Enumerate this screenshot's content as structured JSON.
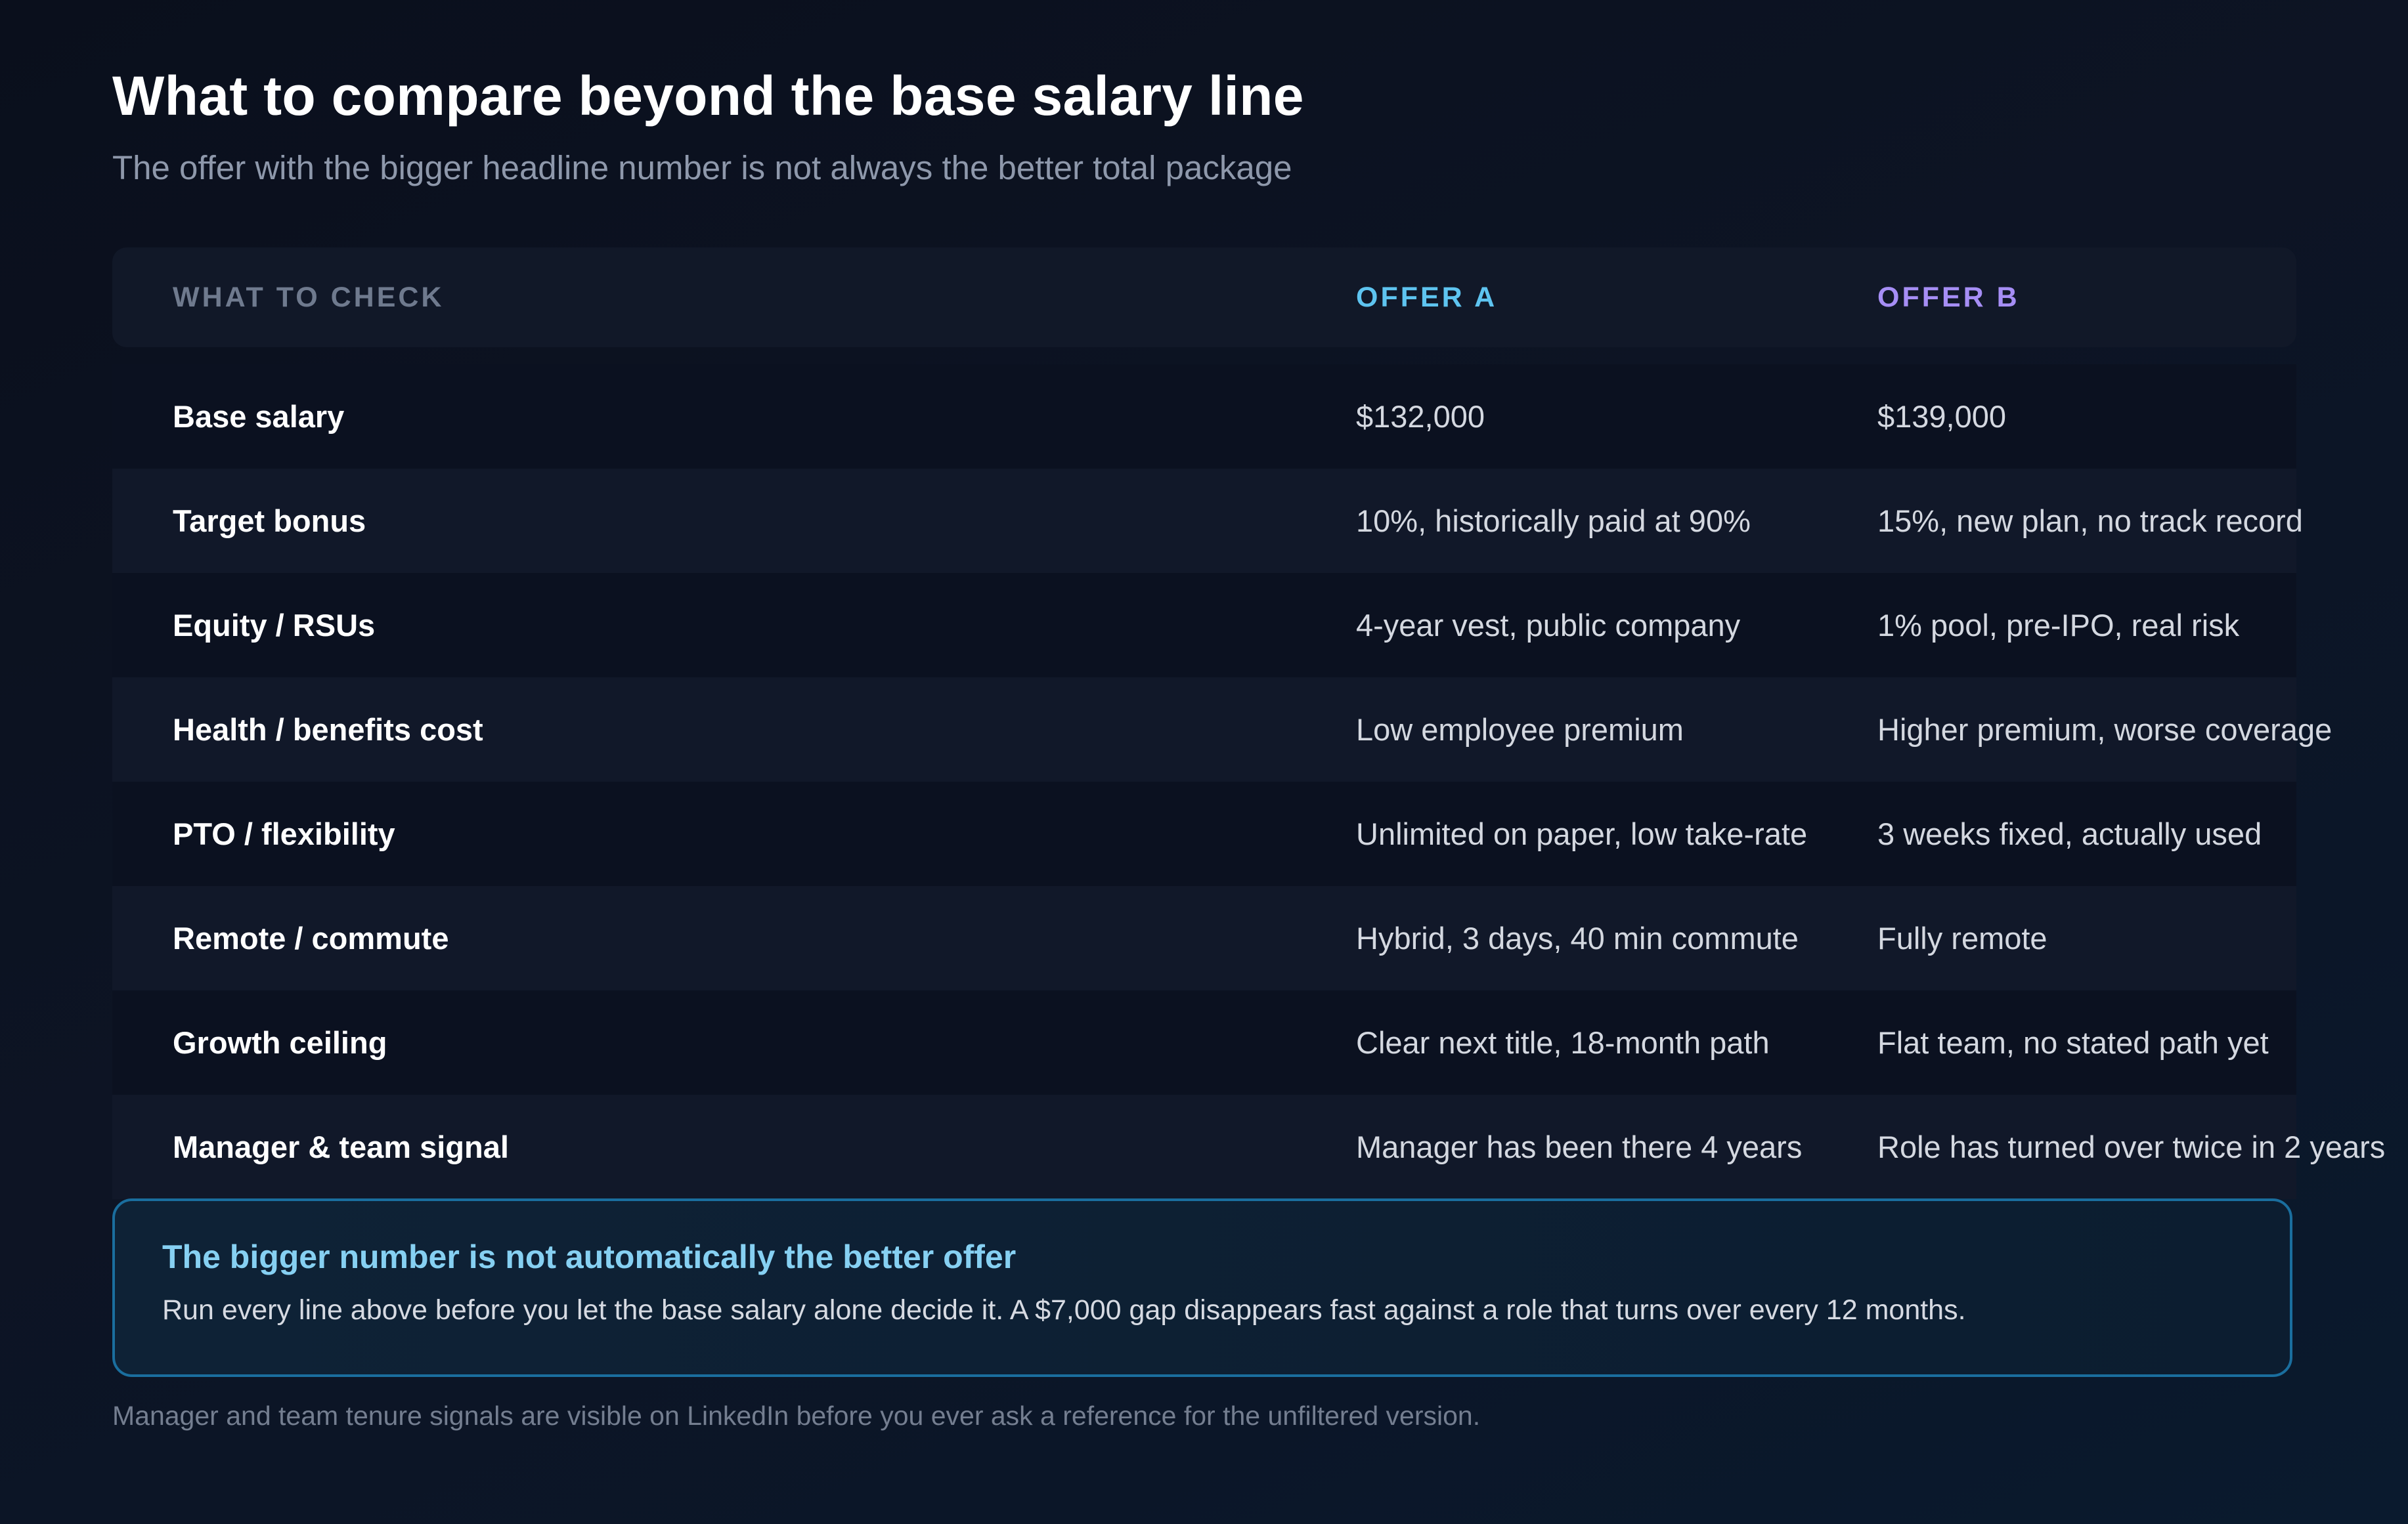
{
  "header": {
    "title": "What to compare beyond the base salary line",
    "subtitle": "The offer with the bigger headline number is not always the better total package"
  },
  "table": {
    "columns": [
      "WHAT TO CHECK",
      "OFFER A",
      "OFFER B"
    ],
    "rows": [
      {
        "label": "Base salary",
        "offer_a": "$132,000",
        "offer_b": "$139,000"
      },
      {
        "label": "Target bonus",
        "offer_a": "10%, historically paid at 90%",
        "offer_b": "15%, new plan, no track record"
      },
      {
        "label": "Equity / RSUs",
        "offer_a": "4-year vest, public company",
        "offer_b": "1% pool, pre-IPO, real risk"
      },
      {
        "label": "Health / benefits cost",
        "offer_a": "Low employee premium",
        "offer_b": "Higher premium, worse coverage"
      },
      {
        "label": "PTO / flexibility",
        "offer_a": "Unlimited on paper, low take-rate",
        "offer_b": "3 weeks fixed, actually used"
      },
      {
        "label": "Remote / commute",
        "offer_a": "Hybrid, 3 days, 40 min commute",
        "offer_b": "Fully remote"
      },
      {
        "label": "Growth ceiling",
        "offer_a": "Clear next title, 18-month path",
        "offer_b": "Flat team, no stated path yet"
      },
      {
        "label": "Manager & team signal",
        "offer_a": "Manager has been there 4 years",
        "offer_b": "Role has turned over twice in 2 years"
      }
    ]
  },
  "callout": {
    "title": "The bigger number is not automatically the better offer",
    "body": "Run every line above before you let the base salary alone decide it. A $7,000 gap disappears fast against a role that turns over every 12 months."
  },
  "footnote": "Manager and team tenure signals are visible on LinkedIn before you ever ask a reference for the unfiltered version.",
  "colors": {
    "background": "#0a0f1c",
    "offer_a_accent": "#5ec4f0",
    "offer_b_accent": "#a68ef5",
    "callout_border": "#1a6e9e",
    "callout_title": "#86d0f2"
  }
}
